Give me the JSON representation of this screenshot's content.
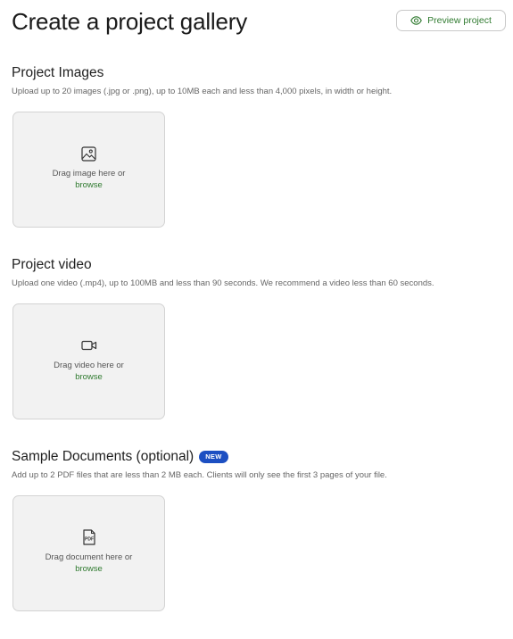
{
  "header": {
    "title": "Create a project gallery",
    "preview_button": {
      "label": "Preview project",
      "icon": "eye-icon",
      "accent_color": "#2f7a2f"
    }
  },
  "sections": [
    {
      "title": "Project Images",
      "description": "Upload up to 20 images (.jpg or .png), up to 10MB each and less than 4,000 pixels, in width or height.",
      "dropzone": {
        "icon": "image-icon",
        "text": "Drag image here or",
        "link": "browse"
      }
    },
    {
      "title": "Project video",
      "description": "Upload one video (.mp4), up to 100MB and less than 90 seconds. We recommend a video less than 60 seconds.",
      "dropzone": {
        "icon": "video-camera-icon",
        "text": "Drag video here or",
        "link": "browse"
      }
    },
    {
      "title": "Sample Documents (optional)",
      "badge": "NEW",
      "description": "Add up to 2 PDF files that are less than 2 MB each. Clients will only see the first 3 pages of your file.",
      "dropzone": {
        "icon": "pdf-icon",
        "text": "Drag document here or",
        "link": "browse",
        "icon_text": "PDF"
      }
    }
  ],
  "colors": {
    "accent_green": "#2f7a2f",
    "badge_blue": "#1c4fc2",
    "dropzone_bg": "#f2f2f2"
  }
}
